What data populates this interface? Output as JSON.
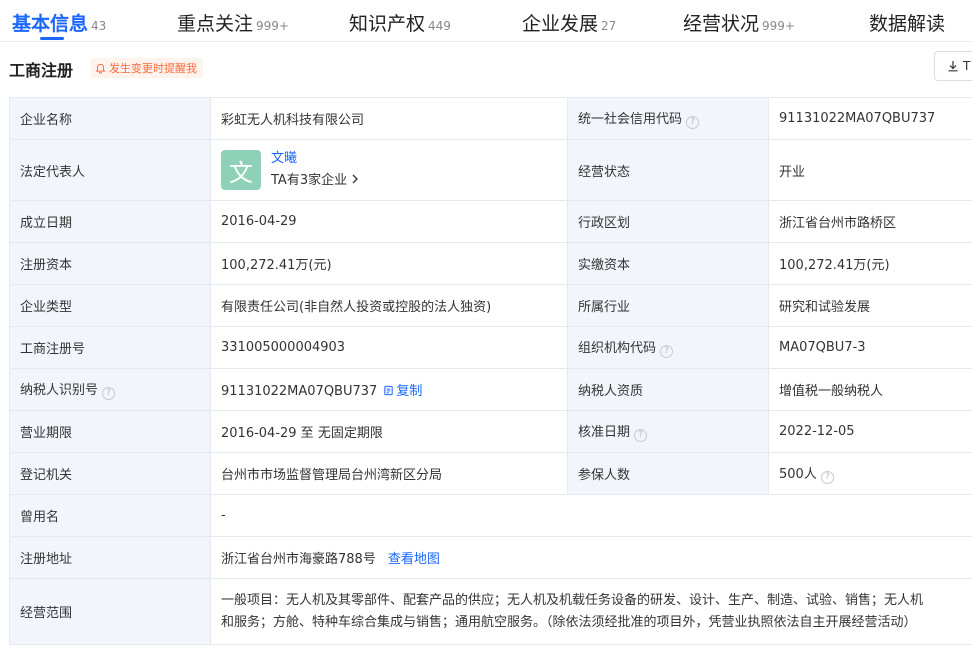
{
  "tabs": [
    {
      "label": "基本信息",
      "count": "43"
    },
    {
      "label": "重点关注",
      "count": "999+"
    },
    {
      "label": "知识产权",
      "count": "449"
    },
    {
      "label": "企业发展",
      "count": "27"
    },
    {
      "label": "经营状况",
      "count": "999+"
    },
    {
      "label": "数据解读",
      "count": ""
    }
  ],
  "section": {
    "title": "工商注册",
    "remind": "发生变更时提醒我",
    "download": "T"
  },
  "info": {
    "company_name_label": "企业名称",
    "company_name": "彩虹无人机科技有限公司",
    "credit_code_label": "统一社会信用代码",
    "credit_code": "91131022MA07QBU737",
    "legal_rep_label": "法定代表人",
    "legal_rep_avatar": "文",
    "legal_rep_name": "文曦",
    "legal_rep_sub": "TA有3家企业",
    "status_label": "经营状态",
    "status": "开业",
    "founded_label": "成立日期",
    "founded": "2016-04-29",
    "region_label": "行政区划",
    "region": "浙江省台州市路桥区",
    "reg_capital_label": "注册资本",
    "reg_capital": "100,272.41万(元)",
    "paid_capital_label": "实缴资本",
    "paid_capital": "100,272.41万(元)",
    "type_label": "企业类型",
    "type": "有限责任公司(非自然人投资或控股的法人独资)",
    "industry_label": "所属行业",
    "industry": "研究和试验发展",
    "reg_no_label": "工商注册号",
    "reg_no": "331005000004903",
    "org_code_label": "组织机构代码",
    "org_code": "MA07QBU7-3",
    "taxpayer_id_label": "纳税人识别号",
    "taxpayer_id": "91131022MA07QBU737",
    "copy_label": "复制",
    "taxpayer_qual_label": "纳税人资质",
    "taxpayer_qual": "增值税一般纳税人",
    "term_label": "营业期限",
    "term": "2016-04-29 至 无固定期限",
    "approve_label": "核准日期",
    "approve": "2022-12-05",
    "authority_label": "登记机关",
    "authority": "台州市市场监督管理局台州湾新区分局",
    "insured_label": "参保人数",
    "insured": "500人",
    "former_label": "曾用名",
    "former": "-",
    "address_label": "注册地址",
    "address": "浙江省台州市海豪路788号",
    "map_link": "查看地图",
    "scope_label": "经营范围",
    "scope_line1": "一般项目：无人机及其零部件、配套产品的供应；无人机及机载任务设备的研发、设计、生产、制造、试验、销售；无人机",
    "scope_line2": "和服务；方舱、特种车综合集成与销售；通用航空服务。（除依法须经批准的项目外，凭营业执照依法自主开展经营活动）"
  },
  "colors": {
    "accent": "#1a66ff",
    "label_bg": "#f2f6fc",
    "warn": "#ff6a3d"
  }
}
